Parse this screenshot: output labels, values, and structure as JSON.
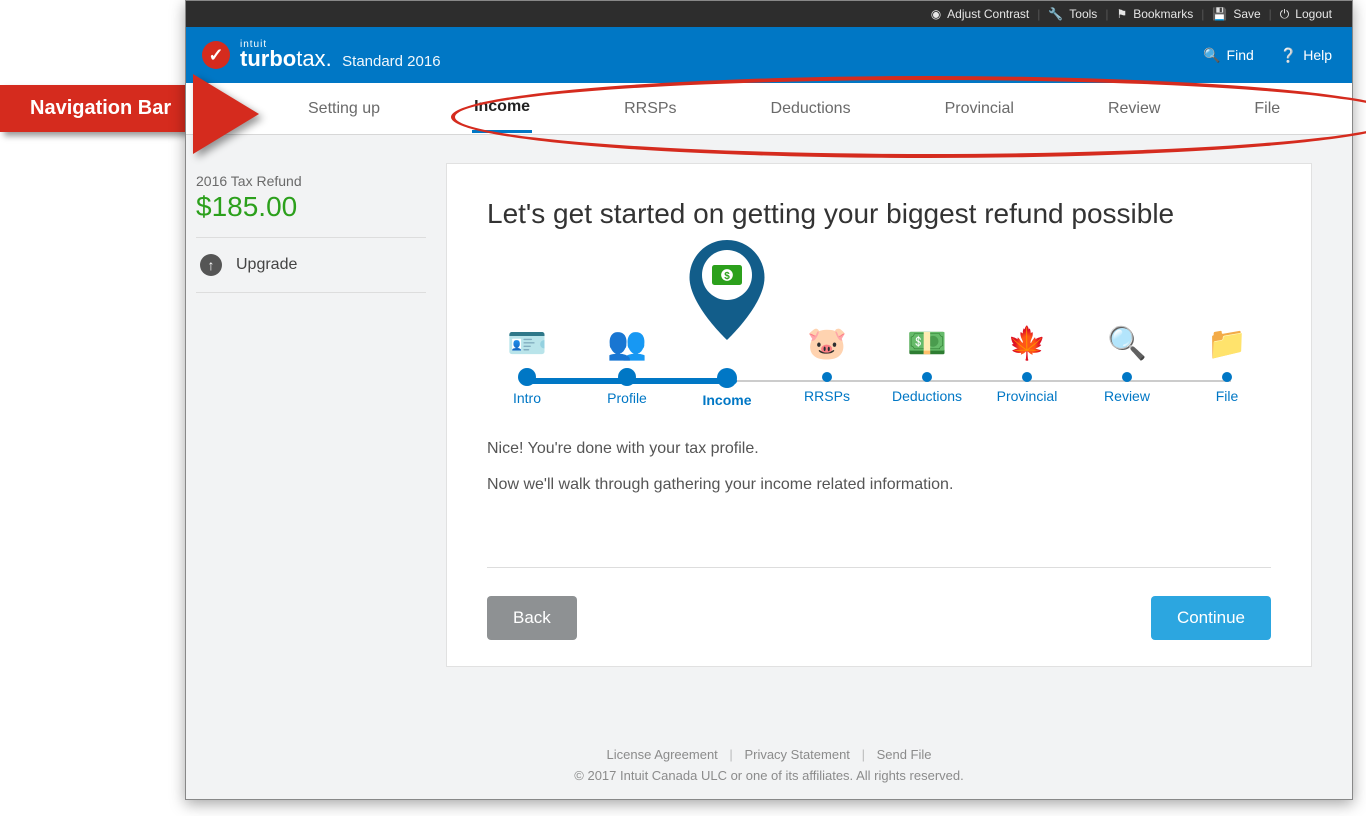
{
  "topbar": {
    "contrast": "Adjust Contrast",
    "tools": "Tools",
    "bookmarks": "Bookmarks",
    "save": "Save",
    "logout": "Logout"
  },
  "brand": {
    "intuit": "intuit",
    "name_bold": "turbo",
    "name_rest": "tax",
    "edition": "Standard 2016",
    "find": "Find",
    "help": "Help"
  },
  "nav": {
    "items": [
      {
        "label": "Setting up"
      },
      {
        "label": "Income",
        "active": true
      },
      {
        "label": "RRSPs"
      },
      {
        "label": "Deductions"
      },
      {
        "label": "Provincial"
      },
      {
        "label": "Review"
      },
      {
        "label": "File"
      }
    ]
  },
  "sidebar": {
    "refund_label": "2016 Tax Refund",
    "refund_amount": "$185.00",
    "upgrade": "Upgrade"
  },
  "main": {
    "heading": "Let's get started on getting your biggest refund possible",
    "steps": [
      {
        "label": "Intro",
        "state": "done"
      },
      {
        "label": "Profile",
        "state": "done"
      },
      {
        "label": "Income",
        "state": "current"
      },
      {
        "label": "RRSPs",
        "state": "todo"
      },
      {
        "label": "Deductions",
        "state": "todo"
      },
      {
        "label": "Provincial",
        "state": "todo"
      },
      {
        "label": "Review",
        "state": "todo"
      },
      {
        "label": "File",
        "state": "todo"
      }
    ],
    "msg1": "Nice! You're done with your tax profile.",
    "msg2": "Now we'll walk through gathering your income related information.",
    "back": "Back",
    "continue": "Continue"
  },
  "footer": {
    "license": "License Agreement",
    "privacy": "Privacy Statement",
    "sendfile": "Send File",
    "copy": "© 2017 Intuit Canada ULC or one of its affiliates. All rights reserved."
  },
  "annotation": {
    "label": "Navigation Bar"
  }
}
